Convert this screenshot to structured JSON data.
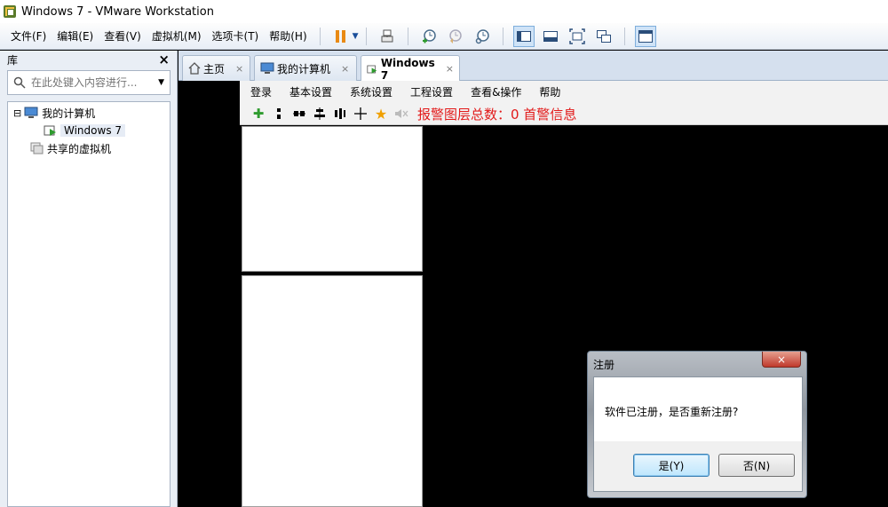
{
  "window": {
    "title": "Windows 7 - VMware Workstation"
  },
  "menubar": {
    "items": [
      "文件(F)",
      "编辑(E)",
      "查看(V)",
      "虚拟机(M)",
      "选项卡(T)",
      "帮助(H)"
    ]
  },
  "library": {
    "title": "库",
    "close": "×",
    "search_placeholder": "在此处键入内容进行...",
    "tree": {
      "my_computer": "我的计算机",
      "vm": "Windows 7",
      "shared": "共享的虚拟机",
      "expander": "⊟"
    }
  },
  "tabs": [
    {
      "label": "主页",
      "close": "×"
    },
    {
      "label": "我的计算机",
      "close": "×"
    },
    {
      "label": "Windows 7",
      "close": "×"
    }
  ],
  "guest": {
    "menu": [
      "登录",
      "基本设置",
      "系统设置",
      "工程设置",
      "查看&操作",
      "帮助"
    ],
    "alarm_text": "报警图层总数：0  首警信息"
  },
  "dialog": {
    "title": "注册",
    "close": "×",
    "message": "软件已注册，是否重新注册?",
    "yes": "是(Y)",
    "no": "否(N)"
  },
  "colors": {
    "accent": "#e98a14",
    "alarm": "#e21a1a",
    "selection": "#cfe3f7"
  }
}
